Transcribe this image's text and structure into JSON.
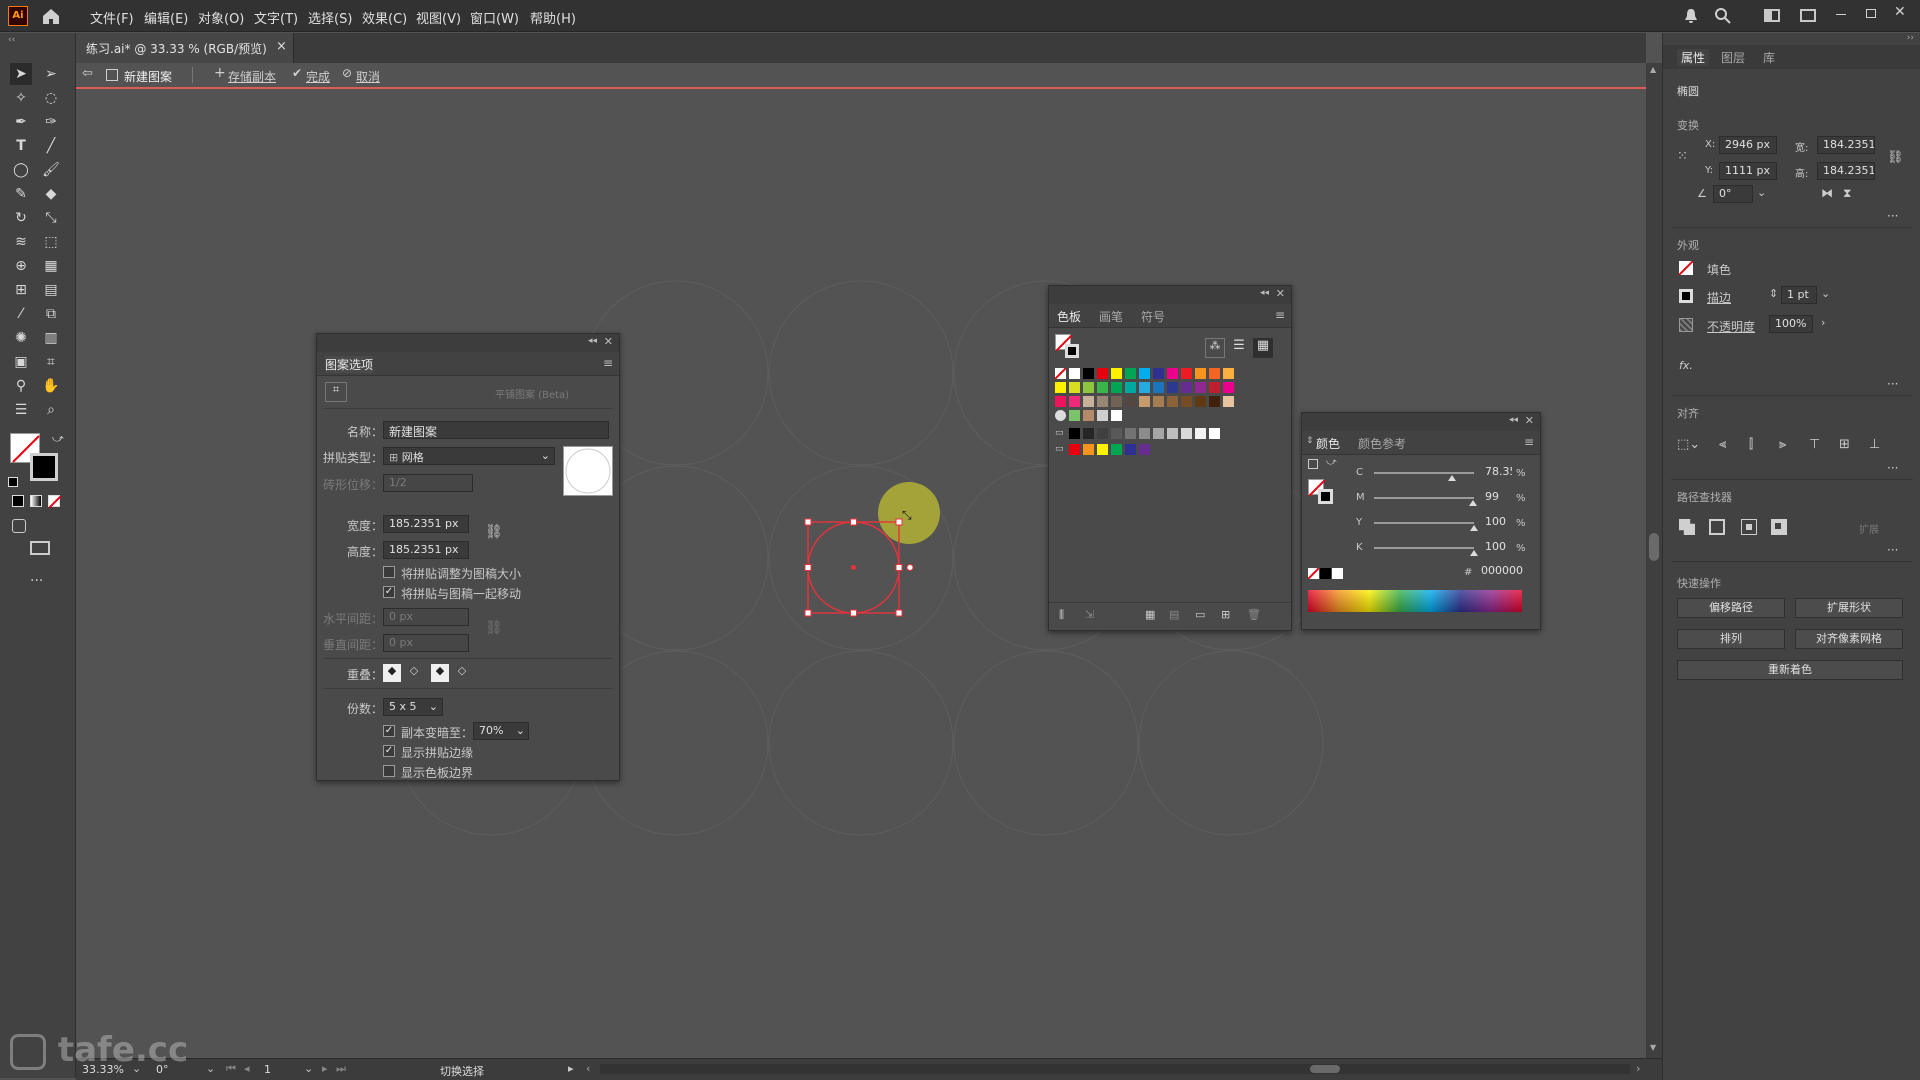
{
  "app": {
    "logo": "Ai"
  },
  "menu": [
    "文件(F)",
    "编辑(E)",
    "对象(O)",
    "文字(T)",
    "选择(S)",
    "效果(C)",
    "视图(V)",
    "窗口(W)",
    "帮助(H)"
  ],
  "document": {
    "tab_title": "练习.ai* @ 33.33 % (RGB/预览)",
    "close": "×"
  },
  "isolation_bar": {
    "name": "新建图案",
    "save_copy": "存储副本",
    "done": "完成",
    "cancel": "取消"
  },
  "pattern_options": {
    "title": "图案选项",
    "tile_tool_label": "拼贴编辑工具",
    "make_pattern_beta": "平铺图案 (Beta)",
    "name_label": "名称：",
    "name_value": "新建图案",
    "tile_type_label": "拼贴类型：",
    "tile_type_value": "网格",
    "brick_offset_label": "砖形位移：",
    "brick_offset_value": "1/2",
    "width_label": "宽度：",
    "width_value": "185.2351 px",
    "height_label": "高度：",
    "height_value": "185.2351 px",
    "size_tile_to_art": "将拼贴调整为图稿大小",
    "size_tile_to_art_checked": false,
    "move_tile_with_art": "将拼贴与图稿一起移动",
    "move_tile_with_art_checked": true,
    "h_spacing_label": "水平间距：",
    "h_spacing_value": "0 px",
    "v_spacing_label": "垂直间距：",
    "v_spacing_value": "0 px",
    "overlap_label": "重叠：",
    "copies_label": "份数：",
    "copies_value": "5 x 5",
    "dim_copies": "副本变暗至：",
    "dim_copies_checked": true,
    "dim_copies_value": "70%",
    "show_tile_edge": "显示拼贴边缘",
    "show_tile_edge_checked": true,
    "show_swatch_bounds": "显示色板边界",
    "show_swatch_bounds_checked": false
  },
  "swatches_panel": {
    "tabs": [
      "色板",
      "画笔",
      "符号"
    ],
    "row1": [
      "#ffffff",
      "#ffffff",
      "#000000",
      "#e8000e",
      "#fff100",
      "#00a651",
      "#00aeef",
      "#2e3192",
      "#ec008c",
      "#ed1c24",
      "#f7941d",
      "#f26522",
      "#fbb040"
    ],
    "row2": [
      "#fff200",
      "#d7df23",
      "#8dc63f",
      "#39b54a",
      "#00a651",
      "#00a99d",
      "#27aae1",
      "#1c75bc",
      "#2b3990",
      "#662d91",
      "#92278f",
      "#be1e2d",
      "#ec008c"
    ],
    "row3": [
      "#ed145b",
      "#ee2a7b",
      "#c7b299",
      "#998675",
      "#736357",
      "#534741",
      "#c69c6d",
      "#a67c52",
      "#8c6239",
      "#754c24",
      "#603913",
      "#42210b",
      "#e5c49f"
    ],
    "row5": [
      "#000000",
      "#262626",
      "#404040",
      "#595959",
      "#737373",
      "#8c8c8c",
      "#a6a6a6",
      "#bfbfbf",
      "#d9d9d9",
      "#f2f2f2",
      "#ffffff"
    ],
    "row6": [
      "#e8000e",
      "#f7941d",
      "#fff100",
      "#00a651",
      "#2e3192",
      "#662d91"
    ]
  },
  "color_panel": {
    "tabs": [
      "颜色",
      "颜色参考"
    ],
    "channels": [
      {
        "name": "C",
        "value": "78.35",
        "level": 0.7835
      },
      {
        "name": "M",
        "value": "99",
        "level": 0.99
      },
      {
        "name": "Y",
        "value": "100",
        "level": 1.0
      },
      {
        "name": "K",
        "value": "100",
        "level": 1.0
      }
    ],
    "percent": "%",
    "hex_label": "#",
    "hex_value": "000000"
  },
  "properties_panel": {
    "tabs": [
      "属性",
      "图层",
      "库"
    ],
    "object_type": "椭圆",
    "transform_label": "变换",
    "x_label": "X:",
    "x_value": "2946 px",
    "y_label": "Y:",
    "y_value": "1111 px",
    "w_label": "宽:",
    "w_value": "184.2351",
    "h_label": "高:",
    "h_value": "184.2351",
    "angle_value": "0°",
    "appearance_label": "外观",
    "fill_label": "填色",
    "stroke_label": "描边",
    "stroke_value": "1 pt",
    "opacity_label": "不透明度",
    "opacity_value": "100%",
    "fx_label": "fx.",
    "align_label": "对齐",
    "pathfinder_label": "路径查找器",
    "expand_label": "扩展",
    "quick_actions_label": "快速操作",
    "offset_path": "偏移路径",
    "expand_shape": "扩展形状",
    "arrange": "排列",
    "align_pixel_grid": "对齐像素网格",
    "recolor": "重新着色"
  },
  "status": {
    "zoom": "33.33%",
    "rotate": "0°",
    "artboard": "1",
    "toggle": "切换选择"
  },
  "watermark": "tafe.cc",
  "colors": {
    "accent_red": "#e05a5a",
    "selection": "#e8323c",
    "cursor_highlight": "#c9c43a"
  }
}
